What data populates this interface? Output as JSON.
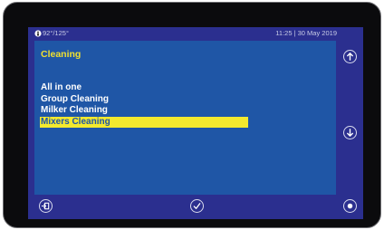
{
  "status": {
    "icon": "thermometer-dial-icon",
    "temperature": "92°/125°",
    "datetime": "11:25 | 30 May 2019"
  },
  "panel": {
    "title": "Cleaning"
  },
  "menu": {
    "items": [
      {
        "label": "All in one",
        "selected": false
      },
      {
        "label": "Group Cleaning",
        "selected": false
      },
      {
        "label": "Milker Cleaning",
        "selected": false
      },
      {
        "label": "Mixers Cleaning",
        "selected": true
      }
    ]
  },
  "buttons": {
    "up": "arrow-up-icon",
    "down": "arrow-down-icon",
    "back": "exit-door-icon",
    "confirm": "checkmark-icon",
    "extra": "circle-action-icon"
  },
  "colors": {
    "screen_bg": "#2b2f8f",
    "panel_bg": "#1f56a6",
    "title": "#f0e030",
    "selection": "#f3e92e"
  }
}
